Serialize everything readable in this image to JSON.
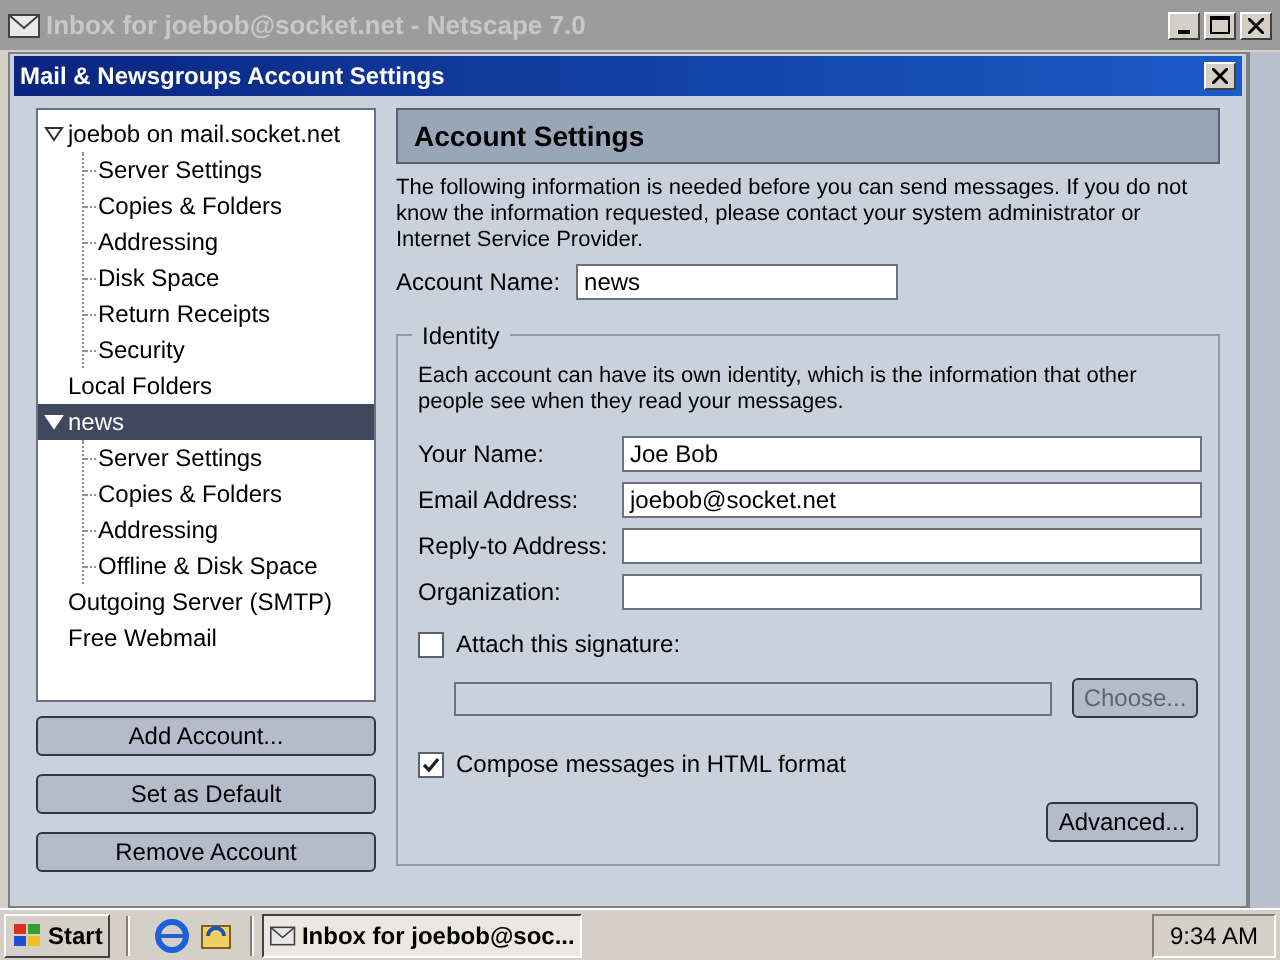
{
  "background_window": {
    "title": "Inbox for joebob@socket.net - Netscape 7.0"
  },
  "dialog": {
    "title": "Mail & Newsgroups Account Settings"
  },
  "tree": [
    {
      "label": "joebob on mail.socket.net",
      "expanded": true,
      "selected": false,
      "children": [
        {
          "label": "Server Settings",
          "selected": false
        },
        {
          "label": "Copies & Folders",
          "selected": false
        },
        {
          "label": "Addressing",
          "selected": false
        },
        {
          "label": "Disk Space",
          "selected": false
        },
        {
          "label": "Return Receipts",
          "selected": false
        },
        {
          "label": "Security",
          "selected": false
        }
      ]
    },
    {
      "label": "Local Folders",
      "selected": false
    },
    {
      "label": "news",
      "expanded": true,
      "selected": true,
      "children": [
        {
          "label": "Server Settings",
          "selected": false
        },
        {
          "label": "Copies & Folders",
          "selected": false
        },
        {
          "label": "Addressing",
          "selected": false
        },
        {
          "label": "Offline & Disk Space",
          "selected": false
        }
      ]
    },
    {
      "label": "Outgoing Server (SMTP)",
      "selected": false
    },
    {
      "label": "Free Webmail",
      "selected": false
    }
  ],
  "account_buttons": [
    "Add Account...",
    "Set as Default",
    "Remove Account"
  ],
  "panel": {
    "title": "Account Settings",
    "intro": "The following information is needed before you can send messages. If you do not know the information requested, please contact your system administrator or Internet Service Provider.",
    "account_name": {
      "label": "Account Name:",
      "value": "news"
    },
    "identity": {
      "legend": "Identity",
      "description": "Each account can have its own identity, which is the information that other people see when they read your messages.",
      "fields": [
        {
          "label": "Your Name:",
          "value": "Joe Bob"
        },
        {
          "label": "Email Address:",
          "value": "joebob@socket.net"
        },
        {
          "label": "Reply-to Address:"
        },
        {
          "label": "Organization:"
        }
      ],
      "signature": {
        "label": "Attach this signature:",
        "checked": false,
        "choose_button": "Choose...",
        "disabled": true
      },
      "html_compose": {
        "label": "Compose messages in HTML format",
        "checked": true
      },
      "advanced_button": "Advanced..."
    }
  },
  "taskbar": {
    "start": "Start",
    "tasks": [
      {
        "label": "Inbox for joebob@soc...",
        "selected": true
      }
    ],
    "clock": "9:34 AM"
  }
}
